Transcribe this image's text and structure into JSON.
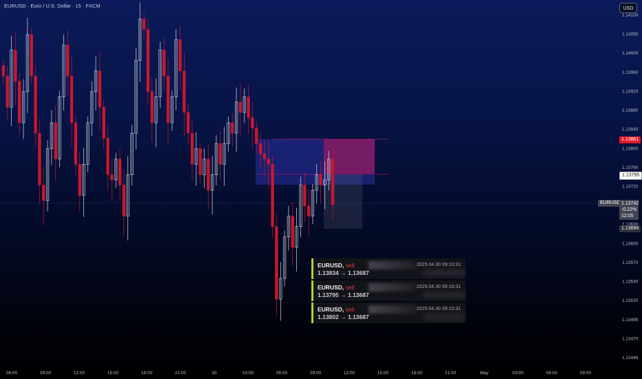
{
  "symbol_title": "EURUSD · Euro / U.S. Dollar · 15 · FXCM",
  "currency_button": "USD",
  "price_axis": {
    "labels": [
      "1.14100",
      "1.14050",
      "1.14000",
      "1.13960",
      "1.13920",
      "1.13880",
      "1.13840",
      "1.13800",
      "1.13760",
      "1.13720",
      "1.13660",
      "1.13630",
      "1.13600",
      "1.13570",
      "1.13545",
      "1.13520",
      "1.13495",
      "1.13470",
      "1.13446"
    ]
  },
  "time_axis": {
    "labels": [
      "06:00",
      "09:00",
      "12:00",
      "15:00",
      "18:00",
      "21:00",
      "30",
      "03:00",
      "06:00",
      "09:00",
      "12:00",
      "15:00",
      "18:00",
      "21:00",
      "May",
      "03:00",
      "06:00",
      "09:00"
    ]
  },
  "price_tags": {
    "high_tag": "1.13861",
    "entry_tag": "1.13795",
    "symbol_tag": "EURUSD",
    "last_price": "1.13742",
    "change": "-0.22%",
    "countdown": "12:05",
    "target_tag": "1.13694"
  },
  "alerts": [
    {
      "symbol": "EURUSD,",
      "side": "sell",
      "time": "2025.04.30 09:10:31",
      "from": "1.13834",
      "arrow": "→",
      "to": "1.13687"
    },
    {
      "symbol": "EURUSD,",
      "side": "sell",
      "time": "2025.04.30 09:10:31",
      "from": "1.13795",
      "arrow": "→",
      "to": "1.13687"
    },
    {
      "symbol": "EURUSD,",
      "side": "sell",
      "time": "2025.04.30 09:10:31",
      "from": "1.13802",
      "arrow": "→",
      "to": "1.13687"
    }
  ],
  "colors": {
    "bull_candle": "#d9dde6",
    "bear_candle": "#c8182f",
    "stop_zone": "#c2185b",
    "profit_zone": "#2a2f7a",
    "alert_accent": "#b5d334",
    "sell_text": "#e8313c"
  },
  "chart_data": {
    "type": "candlestick",
    "symbol": "EURUSD",
    "timeframe": "15",
    "ylim": [
      1.13446,
      1.1411
    ],
    "series": [
      {
        "name": "EURUSD",
        "close": [
          1.1399,
          1.1393,
          1.1404,
          1.1398,
          1.139,
          1.1396,
          1.1407,
          1.1399,
          1.1388,
          1.1378,
          1.1375,
          1.1385,
          1.139,
          1.1383,
          1.1395,
          1.1405,
          1.1399,
          1.139,
          1.1382,
          1.1376,
          1.1382,
          1.139,
          1.1396,
          1.14,
          1.1393,
          1.1387,
          1.138,
          1.1379,
          1.1383,
          1.1378,
          1.1372,
          1.138,
          1.1388,
          1.1402,
          1.141,
          1.1408,
          1.1396,
          1.139,
          1.1395,
          1.1404,
          1.1399,
          1.139,
          1.1395,
          1.1406,
          1.14,
          1.1392,
          1.1388,
          1.1382,
          1.1385,
          1.138,
          1.1383,
          1.1377,
          1.138,
          1.1386,
          1.1382,
          1.1386,
          1.139,
          1.1388,
          1.1394,
          1.1392,
          1.1395,
          1.1391,
          1.1389,
          1.1386,
          1.1384,
          1.1383,
          1.1382,
          1.137,
          1.1356,
          1.136,
          1.1368,
          1.1372,
          1.1366,
          1.137,
          1.1378,
          1.1374,
          1.1372,
          1.1377,
          1.138,
          1.1378,
          1.1379,
          1.1383,
          1.13742
        ]
      }
    ]
  }
}
